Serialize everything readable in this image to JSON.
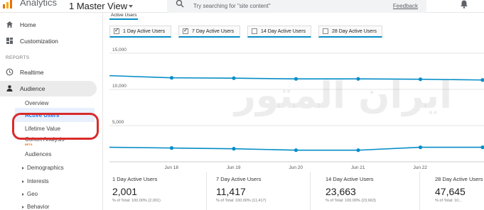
{
  "header": {
    "app_title": "Analytics",
    "view_title": "1 Master View",
    "search_placeholder": "Try searching for \"site content\"",
    "feedback_label": "Feedback"
  },
  "sidebar": {
    "home": "Home",
    "customization": "Customization",
    "reports_section": "REPORTS",
    "realtime": "Realtime",
    "audience": "Audience",
    "sub_items": {
      "overview": "Overview",
      "active_users": "Active Users",
      "lifetime_value": "Lifetime Value",
      "cohort_analysis": "Cohort Analysis",
      "beta": "BETA",
      "audiences": "Audiences",
      "demographics": "Demographics",
      "interests": "Interests",
      "geo": "Geo",
      "behavior": "Behavior"
    }
  },
  "main": {
    "tab_label": "Active Users",
    "toggles": [
      {
        "label": "1 Day Active Users",
        "checked": true
      },
      {
        "label": "7 Day Active Users",
        "checked": true
      },
      {
        "label": "14 Day Active Users",
        "checked": false
      },
      {
        "label": "28 Day Active Users",
        "checked": false
      }
    ],
    "stats": [
      {
        "label": "1 Day Active Users",
        "value": "2,001",
        "pct": "% of Total: 100.00% (2,001)"
      },
      {
        "label": "7 Day Active Users",
        "value": "11,417",
        "pct": "% of Total: 100.00% (11,417)"
      },
      {
        "label": "14 Day Active Users",
        "value": "23,663",
        "pct": "% of Total: 100.00% (23,663)"
      },
      {
        "label": "28 Day Active Users",
        "value": "47,645",
        "pct": "% of Total: 10..."
      }
    ]
  },
  "watermark": "ایران المتور",
  "colors": {
    "series": "#058dc7",
    "highlight": "#d92b2b",
    "active_nav": "#1a73e8"
  },
  "chart_data": {
    "type": "line",
    "x": [
      "",
      "Jun 18",
      "",
      "Jun 19",
      "",
      "Jun 20",
      "",
      "Jun 21",
      "",
      "Jun 22"
    ],
    "x_labels": [
      "Jun 18",
      "Jun 19",
      "Jun 20",
      "Jun 21",
      "Jun 22"
    ],
    "y_ticks": [
      "15,000",
      "10,000",
      "5,000"
    ],
    "ylim": [
      0,
      15000
    ],
    "series": [
      {
        "name": "7 Day Active Users",
        "values": [
          11900,
          11600,
          11550,
          11450,
          11450,
          11400,
          11300
        ]
      },
      {
        "name": "1 Day Active Users",
        "values": [
          2000,
          1900,
          1800,
          1600,
          1600,
          2000,
          2000
        ]
      }
    ]
  }
}
